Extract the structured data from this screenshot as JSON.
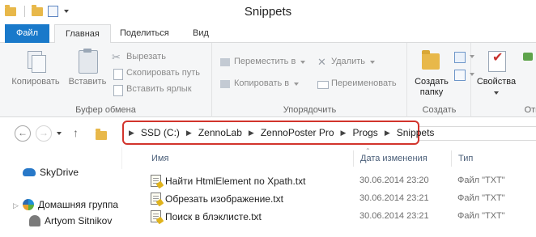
{
  "window": {
    "title": "Snippets"
  },
  "quick_access": {
    "items": [
      "folder-icon",
      "folder-icon",
      "properties-icon"
    ]
  },
  "tabs": [
    "Файл",
    "Главная",
    "Поделиться",
    "Вид"
  ],
  "ribbon": {
    "clipboard": {
      "label": "Буфер обмена",
      "copy": "Копировать",
      "paste": "Вставить",
      "cut": "Вырезать",
      "copy_path": "Скопировать путь",
      "paste_shortcut": "Вставить ярлык"
    },
    "organize": {
      "label": "Упорядочить",
      "move_to": "Переместить в",
      "copy_to": "Копировать в",
      "delete": "Удалить",
      "rename": "Переименовать"
    },
    "new": {
      "label": "Создать",
      "new_folder_line1": "Создать",
      "new_folder_line2": "папку"
    },
    "open": {
      "label": "Отк",
      "properties": "Свойства"
    }
  },
  "address": {
    "crumbs": [
      "SSD (C:)",
      "ZennoLab",
      "ZennoPoster Pro",
      "Progs",
      "Snippets"
    ],
    "highlight_color": "#d2342c"
  },
  "nav_pane": {
    "items": [
      "SkyDrive",
      "Домашняя группа",
      "Artyom Sitnikov"
    ]
  },
  "columns": {
    "name": "Имя",
    "date": "Дата изменения",
    "type": "Тип"
  },
  "files": [
    {
      "name": "Найти HtmlElement по Xpath.txt",
      "date": "30.06.2014 23:20",
      "type": "Файл \"TXT\""
    },
    {
      "name": "Обрезать изображение.txt",
      "date": "30.06.2014 23:21",
      "type": "Файл \"TXT\""
    },
    {
      "name": "Поиск в блэклисте.txt",
      "date": "30.06.2014 23:21",
      "type": "Файл \"TXT\""
    }
  ]
}
